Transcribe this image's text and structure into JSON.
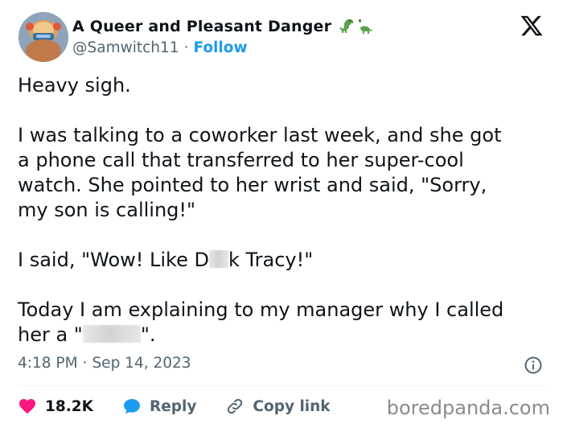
{
  "author": {
    "display_name": "A Queer and Pleasant Danger",
    "handle": "@Samwitch11",
    "separator": "·",
    "follow_label": "Follow",
    "avatar_icon": "avatar-image",
    "name_emoji": "dinosaur-icons"
  },
  "tweet": {
    "paragraphs": {
      "p1": "Heavy sigh.",
      "p2_lines": [
        "I was talking to a coworker last week, and she got",
        "a phone call that transferred to her super-cool",
        "watch. She pointed to her wrist and said, \"Sorry,",
        "my son is calling!\""
      ],
      "p3_before": "I said, \"Wow! Like D",
      "p3_after": "k Tracy!\"",
      "p4_line1": "Today I am explaining to my manager why I called",
      "p4_before": "her a \"",
      "p4_after": "\"."
    },
    "time": "4:18 PM",
    "date": "Sep 14, 2023"
  },
  "actions": {
    "likes": "18.2K",
    "reply_label": "Reply",
    "copy_link_label": "Copy link"
  },
  "watermark": "boredpanda.com",
  "colors": {
    "text": "#0f1419",
    "muted": "#536471",
    "accent": "#1d9bf0",
    "like": "#f91880",
    "divider": "#eff3f4"
  }
}
